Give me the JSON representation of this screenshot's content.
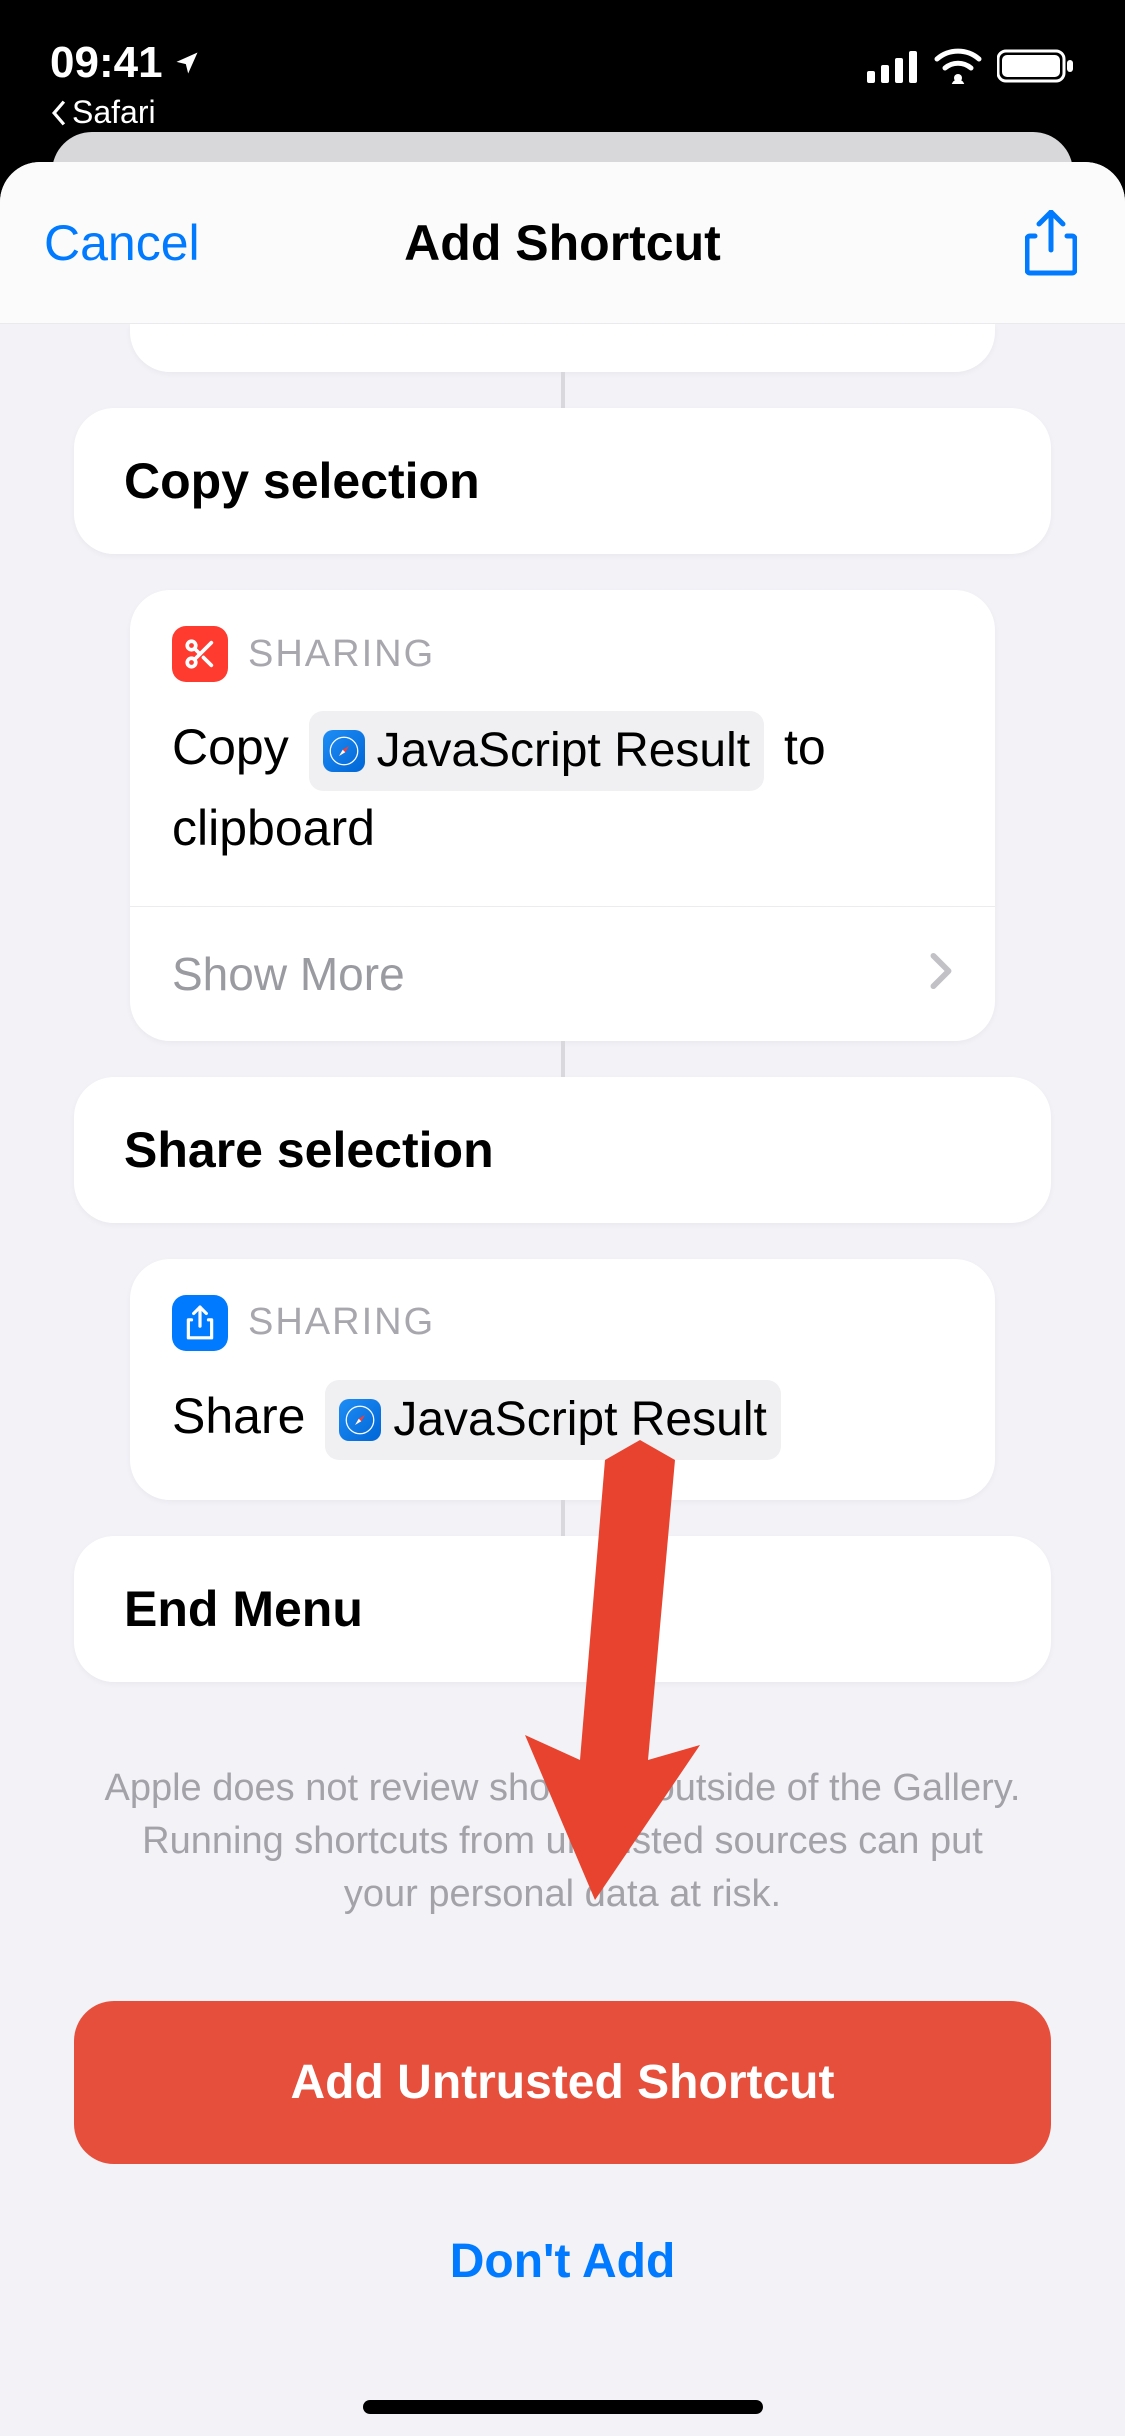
{
  "statusBar": {
    "time": "09:41",
    "backApp": "Safari"
  },
  "sheet": {
    "cancel": "Cancel",
    "title": "Add Shortcut"
  },
  "steps": {
    "copySelection": {
      "title": "Copy selection"
    },
    "sharingCategoryLabel": "SHARING",
    "copyAction": {
      "prefix": "Copy",
      "chip": "JavaScript Result",
      "suffix": "to clipboard",
      "showMore": "Show More"
    },
    "shareSelection": {
      "title": "Share selection"
    },
    "shareAction": {
      "prefix": "Share",
      "chip": "JavaScript Result"
    },
    "endMenu": {
      "title": "End Menu"
    }
  },
  "footer": {
    "warning": "Apple does not review shortcuts outside of the Gallery. Running shortcuts from untrusted sources can put your personal data at risk.",
    "addButton": "Add Untrusted Shortcut",
    "dontAdd": "Don't Add"
  }
}
